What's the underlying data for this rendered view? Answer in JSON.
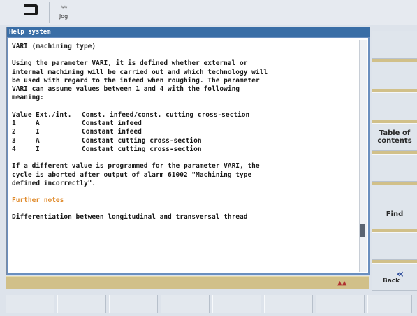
{
  "header": {
    "mode_icon": "mode-bracket-icon",
    "jog_icon": "jog-wave-icon",
    "jog_label": "Jog"
  },
  "help_window": {
    "title": "Help system",
    "heading": "VARI (machining type)",
    "paragraph1": [
      "Using the parameter VARI, it is defined whether external or",
      "internal machining will be carried out and which technology will",
      "be used with regard to the infeed when roughing. The parameter",
      "VARI can assume values between 1 and 4 with the following",
      "meaning:"
    ],
    "table": {
      "headers": [
        "Value",
        "Ext./int.",
        "Const. infeed/const. cutting cross-section"
      ],
      "rows": [
        [
          "1",
          "A",
          "Constant infeed"
        ],
        [
          "2",
          "I",
          "Constant infeed"
        ],
        [
          "3",
          "A",
          "Constant cutting cross-section"
        ],
        [
          "4",
          "I",
          "Constant cutting cross-section"
        ]
      ]
    },
    "paragraph2": [
      "If a different value is programmed for the parameter VARI, the",
      "cycle is aborted after output of alarm 61002 \"Machining type",
      "defined incorrectly\"."
    ],
    "link_further_notes": "Further notes",
    "last_line": "Differentiation between longitudinal and transversal thread"
  },
  "softkeys_right": {
    "table_of_contents_line1": "Table of",
    "table_of_contents_line2": "contents",
    "find": "Find",
    "back": "Back",
    "back_icon": "double-chevron-left-icon"
  },
  "status_icon": "machine-status-icon",
  "colors": {
    "title_bar": "#3a6ea6",
    "link": "#e08a2a",
    "status_bar": "#d1c089"
  }
}
